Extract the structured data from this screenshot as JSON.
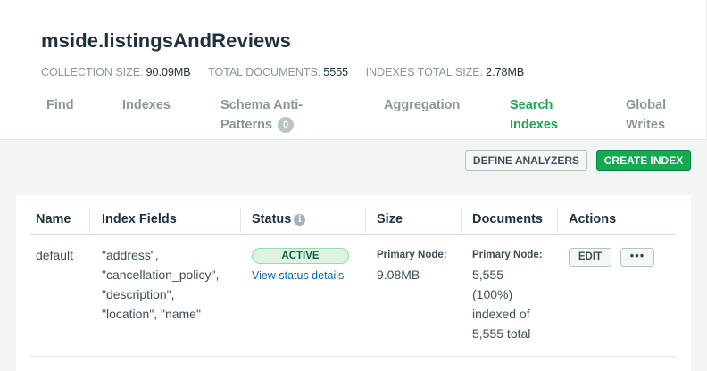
{
  "collection": {
    "title": "mside.listingsAndReviews",
    "stats": [
      {
        "label": "COLLECTION SIZE:",
        "value": "90.09MB"
      },
      {
        "label": "TOTAL DOCUMENTS:",
        "value": "5555"
      },
      {
        "label": "INDEXES TOTAL SIZE:",
        "value": "2.78MB"
      }
    ]
  },
  "tabs": [
    {
      "line1": "Find",
      "line2": ""
    },
    {
      "line1": "Indexes",
      "line2": ""
    },
    {
      "line1": "Schema Anti-",
      "line2": "Patterns",
      "badge": "0"
    },
    {
      "line1": "Aggregation",
      "line2": ""
    },
    {
      "line1": "Search",
      "line2": "Indexes",
      "active": true
    },
    {
      "line1": "Global",
      "line2": "Writes"
    }
  ],
  "toolbar": {
    "define_analyzers": "DEFINE ANALYZERS",
    "create_index": "CREATE INDEX"
  },
  "table": {
    "headers": {
      "name": "Name",
      "fields": "Index Fields",
      "status": "Status",
      "size": "Size",
      "documents": "Documents",
      "actions": "Actions"
    },
    "rows": [
      {
        "name": "default",
        "fields": [
          "\"address\",",
          "\"cancellation_policy\",",
          "\"description\",",
          "\"location\", \"name\""
        ],
        "status_badge": "ACTIVE",
        "status_link": "View status details",
        "size_label": "Primary Node:",
        "size_value": "9.08MB",
        "docs_label": "Primary Node:",
        "docs_lines": [
          "5,555",
          "(100%)",
          "indexed of",
          "5,555 total"
        ],
        "edit_label": "EDIT",
        "more_label": "•••"
      }
    ]
  },
  "colors": {
    "accent_green": "#13aa52",
    "link_blue": "#016bb8",
    "background": "#f1f5f4"
  }
}
